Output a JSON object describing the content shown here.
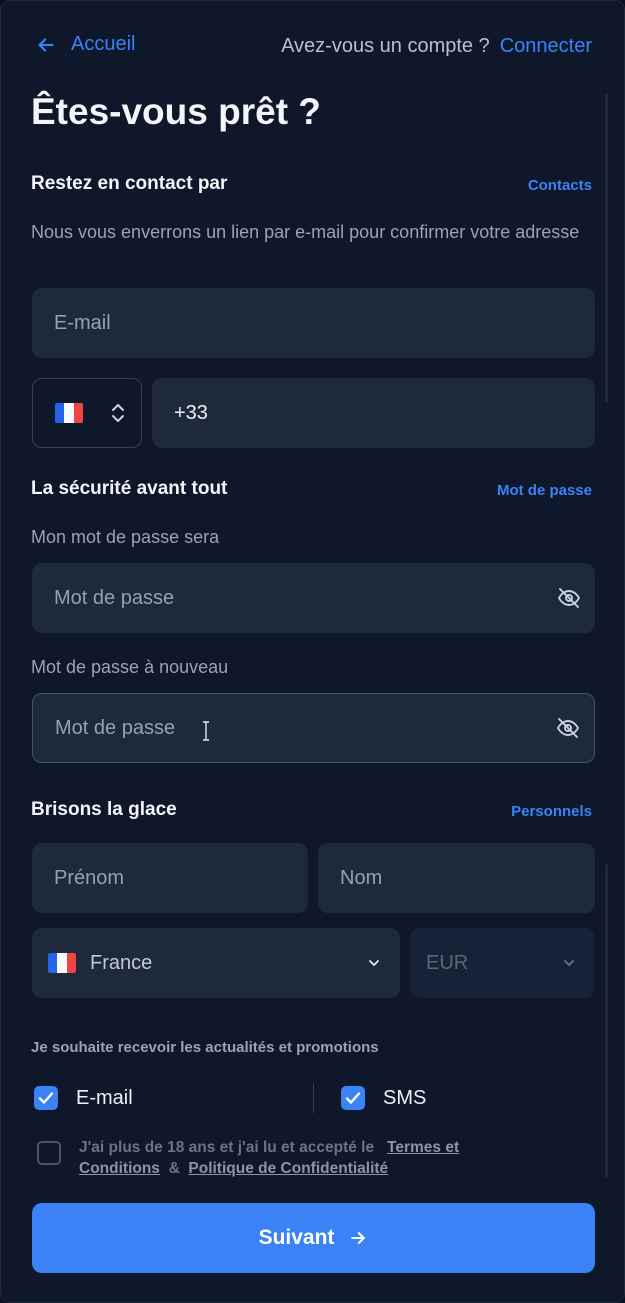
{
  "topbar": {
    "back_label": "Accueil",
    "account_question": "Avez-vous un compte ?",
    "login_link": "Connecter"
  },
  "title": "Êtes-vous prêt ?",
  "contact": {
    "heading": "Restez en contact par",
    "link": "Contacts",
    "description": "Nous vous enverrons un lien par e-mail pour confirmer votre adresse",
    "email_placeholder": "E-mail",
    "phone_code": "+33"
  },
  "security": {
    "heading": "La sécurité avant tout",
    "link": "Mot de passe",
    "password_label": "Mon mot de passe sera",
    "password_placeholder": "Mot de passe",
    "confirm_label": "Mot de passe à nouveau",
    "confirm_placeholder": "Mot de passe"
  },
  "personal": {
    "heading": "Brisons la glace",
    "link": "Personnels",
    "first_name_placeholder": "Prénom",
    "last_name_placeholder": "Nom",
    "country": "France",
    "currency": "EUR"
  },
  "preferences": {
    "promo_label": "Je souhaite recevoir les actualités et promotions",
    "email_option": "E-mail",
    "email_checked": true,
    "sms_option": "SMS",
    "sms_checked": true,
    "terms_prefix": "J'ai plus de 18 ans et j'ai lu et accepté le",
    "terms_link": "Termes et Conditions",
    "terms_and": "&",
    "privacy_link": "Politique de Confidentialité",
    "terms_checked": false
  },
  "submit_label": "Suivant",
  "colors": {
    "background": "#0f172a",
    "field": "#1e293b",
    "accent": "#3b82f6"
  },
  "icons": {
    "back": "arrow-left-icon",
    "eye": "eye-off-icon",
    "phone_selector": "chevron-up-down-icon",
    "dropdown": "chevron-down-icon",
    "check": "check-icon",
    "submit": "arrow-right-icon",
    "flag": "france-flag-icon"
  }
}
